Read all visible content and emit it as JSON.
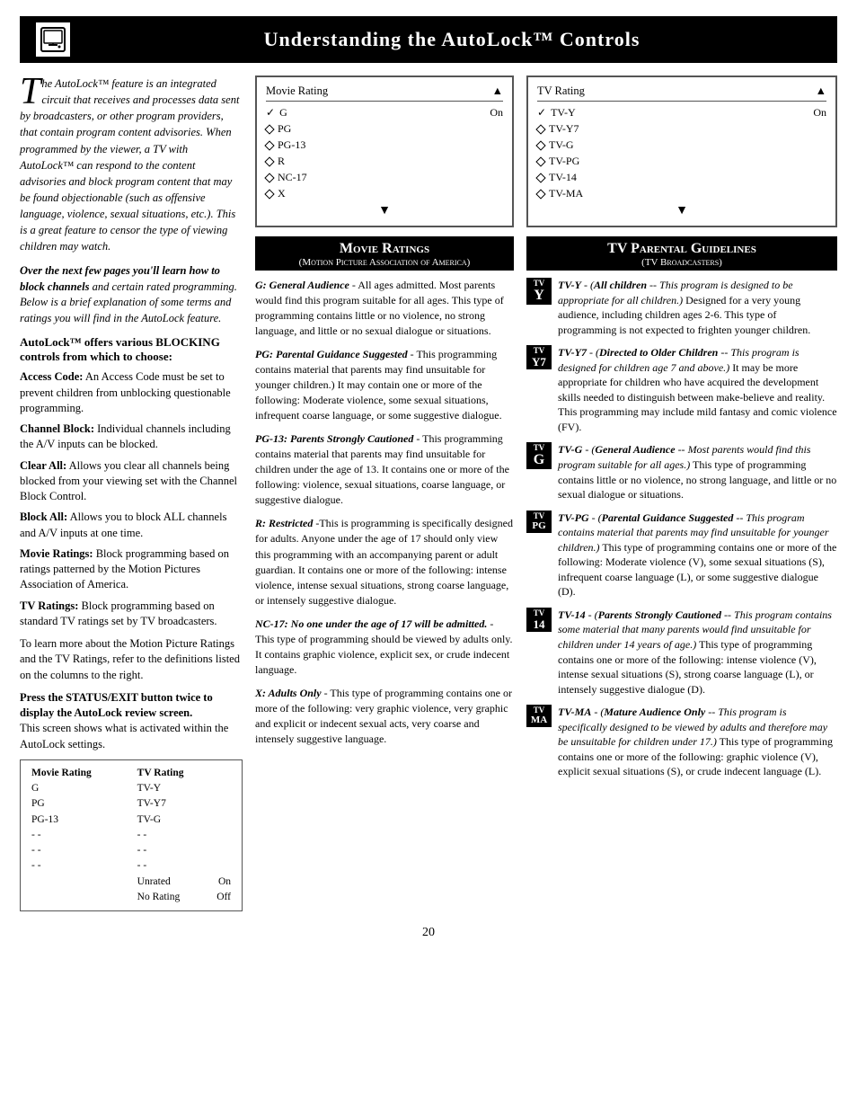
{
  "header": {
    "title": "Understanding the AutoLock™ Controls"
  },
  "intro": {
    "drop_cap": "T",
    "body": "he AutoLock™ feature is an integrated circuit that receives and processes data sent by broadcasters, or other program providers, that contain program content advisories. When programmed by the viewer, a TV with AutoLock™ can respond to the content advisories and block program content that may be found objectionable (such as offensive language, violence, sexual situations, etc.). This is a great feature to censor the type of viewing children may watch."
  },
  "next_pages": "Over the next few pages you'll learn how to block channels and certain rated programming. Below is a brief explanation of some terms and ratings you will find in the AutoLock feature.",
  "blocking_title": "AutoLock™ offers various BLOCKING controls from which to choose:",
  "terms": [
    {
      "name": "Access Code:",
      "desc": "An Access Code must be set to prevent children from unblocking questionable programming."
    },
    {
      "name": "Channel Block:",
      "desc": "Individual channels including the A/V inputs can be blocked."
    },
    {
      "name": "Clear All:",
      "desc": "Allows you clear all channels being blocked from your viewing set with the Channel Block Control."
    },
    {
      "name": "Block All:",
      "desc": "Allows you to block ALL channels and A/V inputs at one time."
    },
    {
      "name": "Movie Ratings:",
      "desc": "Block programming based on ratings patterned by the Motion Pictures Association of America."
    },
    {
      "name": "TV Ratings:",
      "desc": "Block programming based on standard TV ratings set by TV broadcasters."
    }
  ],
  "learn_more": "To learn more about the Motion Picture Ratings and the TV Ratings, refer to the definitions listed on the columns to the right.",
  "status_section": {
    "bold": "Press the STATUS/EXIT button twice to display the AutoLock review screen.",
    "desc": "This screen shows what is activated within the AutoLock settings."
  },
  "movie_screen": {
    "title": "Movie Rating",
    "arrow_up": "▲",
    "items": [
      {
        "type": "check",
        "label": "G",
        "value": "On"
      },
      {
        "type": "diamond",
        "label": "PG"
      },
      {
        "type": "diamond",
        "label": "PG-13"
      },
      {
        "type": "diamond",
        "label": "R"
      },
      {
        "type": "diamond",
        "label": "NC-17"
      },
      {
        "type": "diamond",
        "label": "X"
      }
    ],
    "arrow_down": "▼"
  },
  "tv_screen": {
    "title": "TV Rating",
    "arrow_up": "▲",
    "items": [
      {
        "type": "check",
        "label": "TV-Y",
        "value": "On"
      },
      {
        "type": "diamond",
        "label": "TV-Y7"
      },
      {
        "type": "diamond",
        "label": "TV-G"
      },
      {
        "type": "diamond",
        "label": "TV-PG"
      },
      {
        "type": "diamond",
        "label": "TV-14"
      },
      {
        "type": "diamond",
        "label": "TV-MA"
      }
    ],
    "arrow_down": "▼"
  },
  "movie_ratings_header": {
    "title": "Movie Ratings",
    "sub": "(Motion Picture Association of America)"
  },
  "tv_guidelines_header": {
    "title": "TV Parental Guidelines",
    "sub": "(TV Broadcasters)"
  },
  "movie_rating_descs": [
    {
      "title": "G: General Audience",
      "intro": " - All ages admitted. Most parents would find this program suitable for all ages. This type of programming contains little or no violence, no strong language, and little or no sexual dialogue or situations."
    },
    {
      "title": "PG: Parental Guidance Suggested",
      "intro": " - This programming contains material that parents may find unsuitable for younger children.) It may contain one or more of the following: Moderate violence, some sexual situations, infrequent coarse language, or some suggestive dialogue."
    },
    {
      "title": "PG-13: Parents Strongly Cautioned",
      "intro": " - This programming contains material that parents may find unsuitable for children under the age of 13. It contains one or more of the following: violence, sexual situations, coarse language, or suggestive dialogue."
    },
    {
      "title": "R: Restricted",
      "intro": " -This is programming is specifically designed for adults. Anyone under the age of 17 should only view this programming with an accompanying parent or adult guardian. It contains one or more of the following: intense violence, intense sexual situations, strong coarse language, or intensely suggestive dialogue."
    },
    {
      "title": "NC-17: No one under the age of 17 will be admitted.",
      "intro": " - This type of programming should be viewed by adults only. It contains graphic violence, explicit sex, or crude indecent language."
    },
    {
      "title": "X: Adults Only",
      "intro": " - This type of programming contains one or more of the following: very graphic violence, very graphic and explicit or indecent sexual acts, very coarse and intensely suggestive language."
    }
  ],
  "tv_rating_descs": [
    {
      "badge_top": "TV",
      "badge_main": "Y",
      "title": "TV-Y",
      "bold_desc": "(All children",
      "italic_desc": " -- This program is designed to be appropriate for all children.",
      "rest": ") Designed for a very young audience, including children ages 2-6. This type of programming is not expected to frighten younger children."
    },
    {
      "badge_top": "TV",
      "badge_main": "Y7",
      "title": "TV-Y7",
      "bold_desc": "(Directed to Older Children",
      "italic_desc": " -- This program is designed for children age 7 and above.",
      "rest": ") It may be more appropriate for children who have acquired the development skills needed to distinguish between make-believe and reality. This programming may include mild fantasy and comic violence (FV)."
    },
    {
      "badge_top": "TV",
      "badge_main": "G",
      "title": "TV-G",
      "bold_desc": "(General Audience",
      "italic_desc": " -- Most parents would find this program suitable for all ages.",
      "rest": ") This type of programming contains little or no violence, no strong language, and little or no sexual dialogue or situations."
    },
    {
      "badge_top": "TV",
      "badge_main": "PG",
      "title": "TV-PG",
      "bold_desc": "(Parental Guidance Suggested",
      "italic_desc": " -- This program contains material that parents may find unsuitable for younger children.",
      "rest": ") This type of programming contains one or more of the following: Moderate violence (V), some sexual situations (S), infrequent coarse language (L), or some suggestive dialogue (D)."
    },
    {
      "badge_top": "TV",
      "badge_main": "14",
      "title": "TV-14",
      "bold_desc": "(Parents Strongly Cautioned",
      "italic_desc": " -- This program contains some material that many parents would find unsuitable for children under 14 years of age.",
      "rest": ") This type of programming contains one or more of the following: intense violence (V), intense sexual situations (S), strong coarse language (L), or intensely suggestive dialogue (D)."
    },
    {
      "badge_top": "TV",
      "badge_main": "MA",
      "title": "TV-MA",
      "bold_desc": "(Mature Audience Only",
      "italic_desc": " -- This program is specifically designed to be viewed by adults and therefore may be unsuitable for children under 17.",
      "rest": ") This type of programming contains one or more of the following: graphic violence (V), explicit sexual situations (S), or crude indecent language (L)."
    }
  ],
  "review_screen": {
    "col1_header": "Movie Rating",
    "col2_header": "TV Rating",
    "col1_items": [
      "G",
      "PG",
      "PG-13",
      "- -",
      "- -",
      "- -"
    ],
    "col2_items": [
      "TV-Y",
      "TV-Y7",
      "TV-G",
      "- -",
      "- -",
      "- -"
    ],
    "bottom": [
      {
        "label": "Unrated",
        "value": "On"
      },
      {
        "label": "No Rating",
        "value": "Off"
      }
    ]
  },
  "page_number": "20"
}
